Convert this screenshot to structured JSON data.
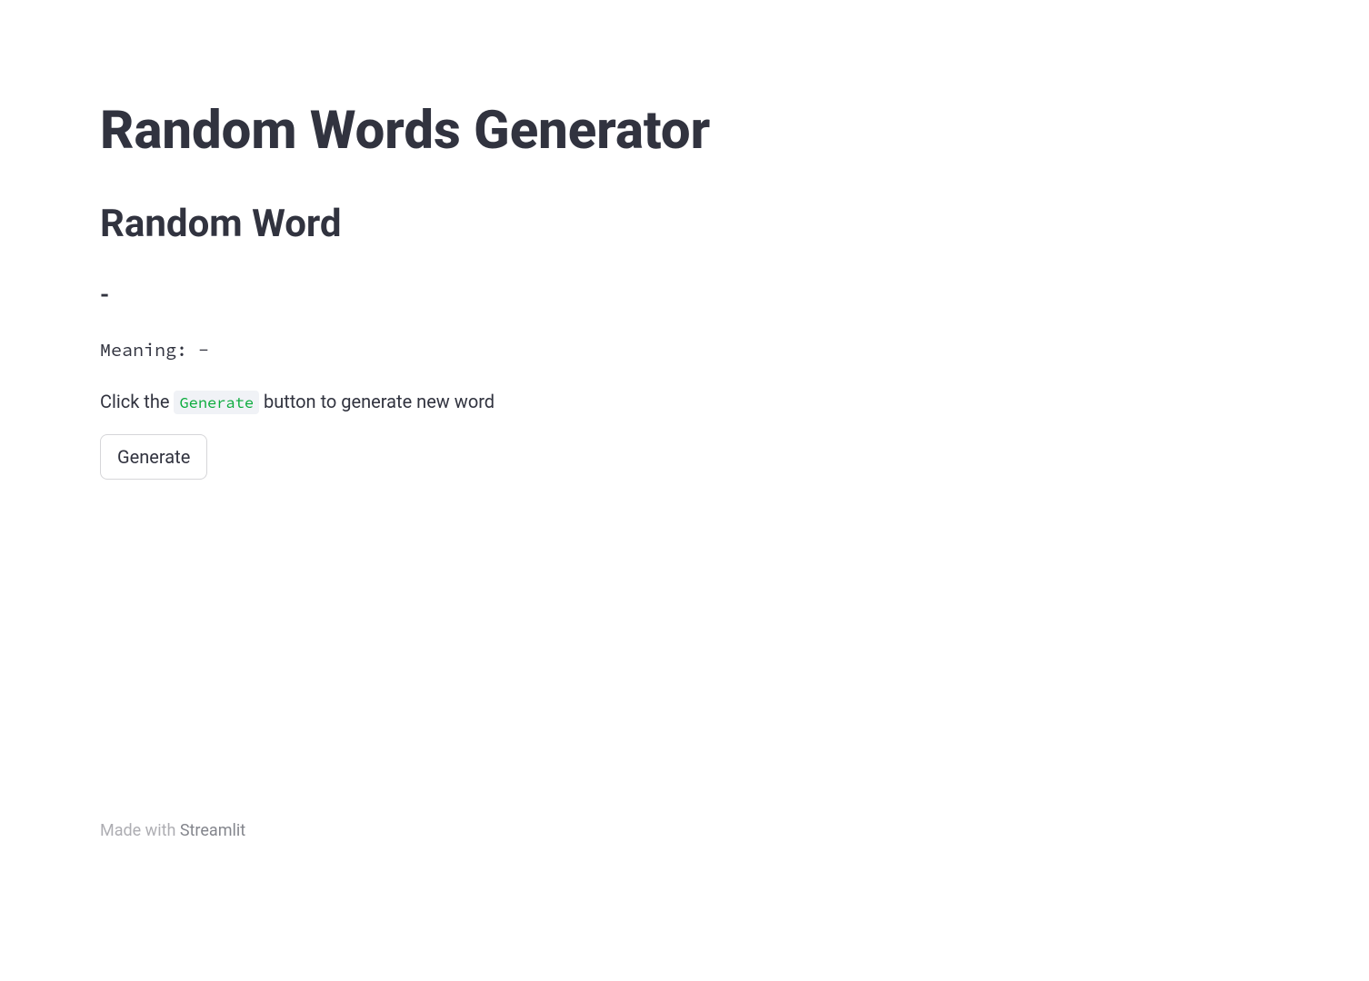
{
  "title": "Random Words Generator",
  "header": "Random Word",
  "word": "-",
  "meaning_label": "Meaning: ",
  "meaning_value": "-",
  "instruction_prefix": "Click the ",
  "instruction_code": "Generate",
  "instruction_suffix": " button to generate new word",
  "button_label": "Generate",
  "footer": {
    "prefix": "Made with ",
    "brand": "Streamlit"
  }
}
